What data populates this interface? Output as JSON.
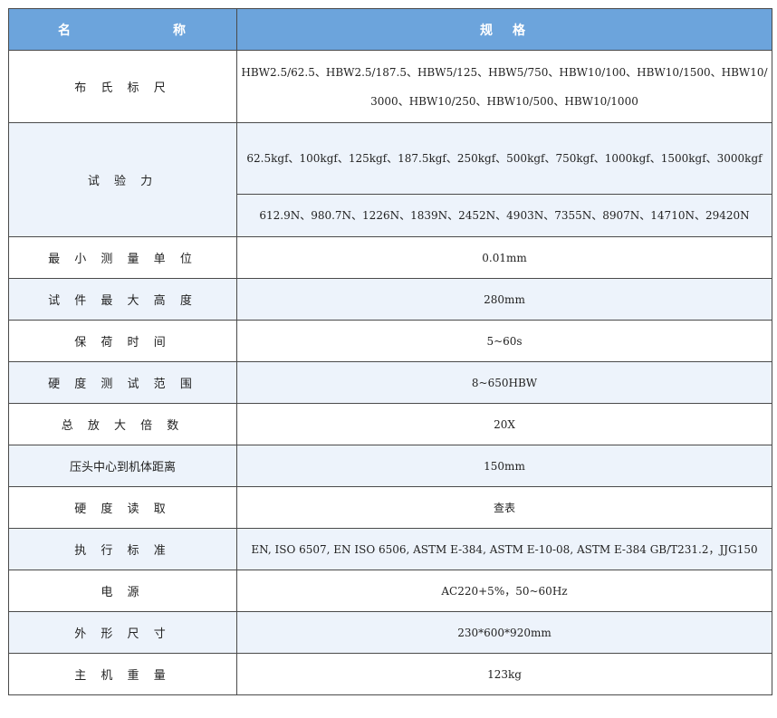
{
  "header": {
    "name_part1": "名",
    "name_part2": "称",
    "spec": "规　格"
  },
  "rows": [
    {
      "name": "布 氏 标 尺",
      "spec": "HBW2.5/62.5、HBW2.5/187.5、HBW5/125、HBW5/750、HBW10/100、HBW10/1500、HBW10/3000、HBW10/250、HBW10/500、HBW10/1000"
    },
    {
      "name": "试 验 力",
      "spec_kgf": "62.5kgf、100kgf、125kgf、187.5kgf、250kgf、500kgf、750kgf、1000kgf、1500kgf、3000kgf",
      "spec_n": "612.9N、980.7N、1226N、1839N、2452N、4903N、7355N、8907N、14710N、29420N"
    },
    {
      "name": "最 小 测 量 单 位",
      "spec": "0.01mm"
    },
    {
      "name": "试 件 最 大 高 度",
      "spec": "280mm"
    },
    {
      "name": "保 荷 时 间",
      "spec": "5~60s"
    },
    {
      "name": "硬 度 测 试 范 围",
      "spec": "8~650HBW"
    },
    {
      "name": "总 放 大 倍 数",
      "spec": "20X"
    },
    {
      "name": "压头中心到机体距离",
      "spec": "150mm"
    },
    {
      "name": "硬 度 读 取",
      "spec": "查表"
    },
    {
      "name": "执 行 标 准",
      "spec": "EN, ISO 6507, EN ISO 6506, ASTM E-384, ASTM E-10-08, ASTM E-384 GB/T231.2，JJG150"
    },
    {
      "name": "电 源",
      "spec": "AC220+5%，50~60Hz"
    },
    {
      "name": "外 形 尺 寸",
      "spec": "230*600*920mm"
    },
    {
      "name": "主 机 重 量",
      "spec": "123kg"
    }
  ]
}
